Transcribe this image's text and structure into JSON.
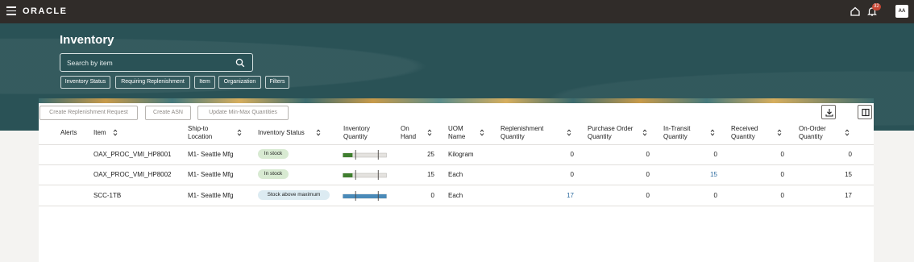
{
  "header": {
    "logo": "ORACLE",
    "notification_count": "32",
    "avatar_initials": "AA"
  },
  "page": {
    "title": "Inventory",
    "search_placeholder": "Search by item"
  },
  "filters": [
    "Inventory Status",
    "Requiring Replenishment",
    "Item",
    "Organization",
    "Filters"
  ],
  "actions": {
    "create_replenishment": "Create Replenishment Request",
    "create_asn": "Create ASN",
    "update_minmax": "Update Min-Max Quantities"
  },
  "table": {
    "headers": {
      "alerts": "Alerts",
      "item": "Item",
      "ship_to_1": "Ship-to",
      "ship_to_2": "Location",
      "inventory_status": "Inventory Status",
      "inv_qty_1": "Inventory",
      "inv_qty_2": "Quantity",
      "on_hand_1": "On",
      "on_hand_2": "Hand",
      "uom_1": "UOM",
      "uom_2": "Name",
      "repl_1": "Replenishment",
      "repl_2": "Quantity",
      "po_1": "Purchase Order",
      "po_2": "Quantity",
      "transit_1": "In-Transit",
      "transit_2": "Quantity",
      "received_1": "Received",
      "received_2": "Quantity",
      "onorder_1": "On-Order",
      "onorder_2": "Quantity"
    },
    "rows": [
      {
        "item": "OAX_PROC_VMI_HP8001",
        "location": "M1- Seattle Mfg",
        "status": "In stock",
        "status_kind": "ok",
        "level": 0.22,
        "on_hand": "25",
        "uom": "Kilogram",
        "replenishment": "0",
        "purchase_order": "0",
        "in_transit": "0",
        "received": "0",
        "on_order": "0"
      },
      {
        "item": "OAX_PROC_VMI_HP8002",
        "location": "M1- Seattle Mfg",
        "status": "In stock",
        "status_kind": "ok",
        "level": 0.22,
        "on_hand": "15",
        "uom": "Each",
        "replenishment": "0",
        "purchase_order": "0",
        "in_transit": "15",
        "received": "0",
        "on_order": "15"
      },
      {
        "item": "SCC-1TB",
        "location": "M1- Seattle Mfg",
        "status": "Stock above maximum",
        "status_kind": "above",
        "level": 1.0,
        "on_hand": "0",
        "uom": "Each",
        "replenishment": "17",
        "purchase_order": "0",
        "in_transit": "0",
        "received": "0",
        "on_order": "17"
      }
    ]
  },
  "colors": {
    "hero": "#2a5256",
    "topbar": "#302c29",
    "in_stock_bar": "#3f7e2f",
    "above_max_bar": "#4a8ab8",
    "link": "#2d6b9f"
  }
}
